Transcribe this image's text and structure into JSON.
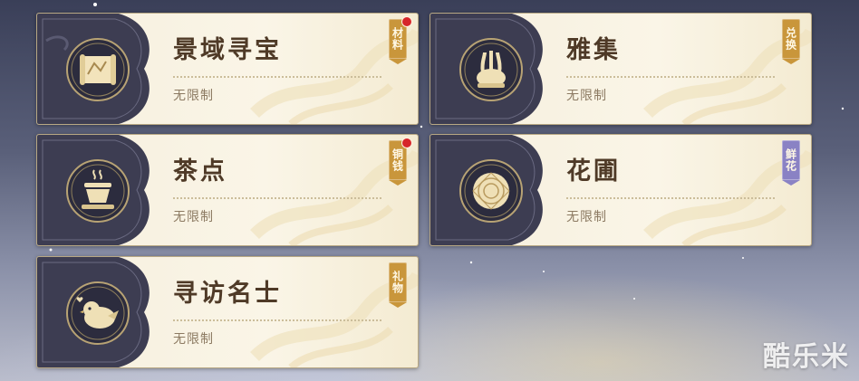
{
  "cards": [
    {
      "title": "景域寻宝",
      "limit": "无限制",
      "tag": "材料",
      "tag_color": "#c9963b",
      "badge": true,
      "icon": "scroll-map-icon"
    },
    {
      "title": "雅集",
      "limit": "无限制",
      "tag": "兑换",
      "tag_color": "#c9963b",
      "badge": false,
      "icon": "incense-vessel-icon"
    },
    {
      "title": "茶点",
      "limit": "无限制",
      "tag": "铜钱",
      "tag_color": "#c9963b",
      "badge": true,
      "icon": "tea-cup-icon"
    },
    {
      "title": "花圃",
      "limit": "无限制",
      "tag": "鲜花",
      "tag_color": "#8a82c4",
      "badge": false,
      "icon": "flower-icon"
    },
    {
      "title": "寻访名士",
      "limit": "无限制",
      "tag": "礼物",
      "tag_color": "#c9963b",
      "badge": false,
      "icon": "bird-icon"
    }
  ],
  "watermark": "酷乐米"
}
